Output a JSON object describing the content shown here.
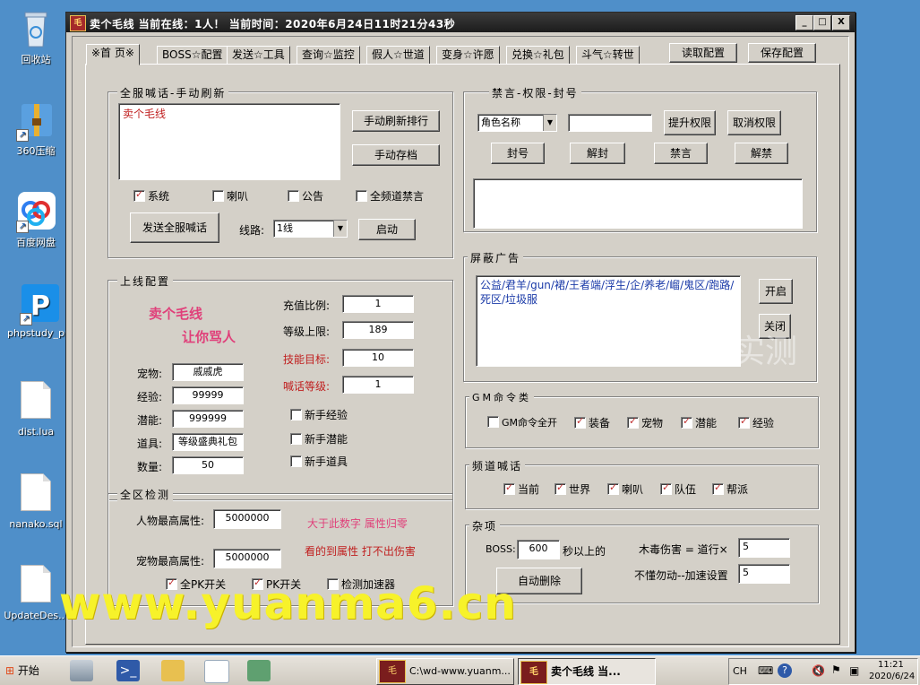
{
  "desktop": {
    "icons": [
      {
        "label": "回收站"
      },
      {
        "label": "360压缩"
      },
      {
        "label": "百度网盘"
      },
      {
        "label": "phpstudy_pro"
      },
      {
        "label": "dist.lua"
      },
      {
        "label": "nanako.sql"
      },
      {
        "label": "UpdateDes..."
      }
    ]
  },
  "window": {
    "title": "卖个毛线    当前在线：1人！  当前时间：2020年6月24日11时21分43秒",
    "title_icon": "毛",
    "controls": [
      "_",
      "□",
      "X"
    ]
  },
  "tabs": [
    {
      "label": "※首 页※",
      "active": true
    },
    {
      "label": "BOSS☆配置"
    },
    {
      "label": "发送☆工具"
    },
    {
      "label": "查询☆监控"
    },
    {
      "label": "假人☆世道"
    },
    {
      "label": "变身☆许愿"
    },
    {
      "label": "兑换☆礼包"
    },
    {
      "label": "斗气☆转世"
    }
  ],
  "toolbar": {
    "read_config": "读取配置",
    "save_config": "保存配置"
  },
  "broadcast": {
    "title": "全服喊话-手动刷新",
    "text": "卖个毛线",
    "refresh_btn": "手动刷新排行",
    "archive_btn": "手动存档",
    "checks": [
      {
        "label": "系统",
        "checked": true
      },
      {
        "label": "喇叭",
        "checked": false
      },
      {
        "label": "公告",
        "checked": false
      },
      {
        "label": "全频道禁言",
        "checked": false
      }
    ],
    "send_btn": "发送全服喊话",
    "line_label": "线路:",
    "line_value": "1线",
    "start_btn": "启动"
  },
  "ban": {
    "title": "禁言-权限-封号",
    "role_select": "角色名称",
    "name_value": "",
    "raise_btn": "提升权限",
    "cancel_btn": "取消权限",
    "ban_btn": "封号",
    "unban_btn": "解封",
    "mute_btn": "禁言",
    "unmute_btn": "解禁"
  },
  "online": {
    "title": "上线配置",
    "slogan1": "卖个毛线",
    "slogan2": "让你骂人",
    "pet_label": "宠物:",
    "pet_value": "戚戚虎",
    "exp_label": "经验:",
    "exp_value": "99999",
    "pot_label": "潜能:",
    "pot_value": "999999",
    "item_label": "道具:",
    "item_value": "等级盛典礼包",
    "qty_label": "数量:",
    "qty_value": "50",
    "ratio_label": "充值比例:",
    "ratio_value": "1",
    "level_label": "等级上限:",
    "level_value": "189",
    "skill_label": "技能目标:",
    "skill_value": "10",
    "shout_label": "喊话等级:",
    "shout_value": "1",
    "newbie_checks": [
      {
        "label": "新手经验",
        "checked": false
      },
      {
        "label": "新手潜能",
        "checked": false
      },
      {
        "label": "新手道具",
        "checked": false
      }
    ]
  },
  "adblock": {
    "title": "屏蔽广告",
    "text": "公益/君羊/gun/裙/王者端/浮生/企/养老/嵧/鬼区/跑路/死区/垃圾服",
    "on_btn": "开启",
    "off_btn": "关闭",
    "faded": "实测"
  },
  "gm": {
    "title": "GM命令类",
    "checks": [
      {
        "label": "GM命令全开",
        "checked": false
      },
      {
        "label": "装备",
        "checked": true
      },
      {
        "label": "宠物",
        "checked": true
      },
      {
        "label": "潜能",
        "checked": true
      },
      {
        "label": "经验",
        "checked": true
      }
    ]
  },
  "channel": {
    "title": "频道喊话",
    "checks": [
      {
        "label": "当前",
        "checked": true
      },
      {
        "label": "世界",
        "checked": true
      },
      {
        "label": "喇叭",
        "checked": true
      },
      {
        "label": "队伍",
        "checked": true
      },
      {
        "label": "帮派",
        "checked": true
      }
    ]
  },
  "zone": {
    "title": "全区检测",
    "char_label": "人物最高属性:",
    "char_value": "5000000",
    "pet_label": "宠物最高属性:",
    "pet_value": "5000000",
    "note1": "大于此数字 属性归零",
    "note2": "看的到属性 打不出伤害",
    "checks": [
      {
        "label": "全PK开关",
        "checked": true
      },
      {
        "label": "PK开关",
        "checked": true
      },
      {
        "label": "检测加速器",
        "checked": false
      }
    ]
  },
  "misc": {
    "title": "杂项",
    "boss_label": "BOSS:",
    "boss_value": "600",
    "boss_suffix": "秒以上的",
    "auto_delete_btn": "自动删除",
    "poison_label": "木毒伤害 = 道行×",
    "poison_value": "5",
    "speed_label": "不懂勿动--加速设置",
    "speed_value": "5"
  },
  "watermark": "www.yuanma6.cn",
  "taskbar": {
    "start": "开始",
    "tasks": [
      {
        "label": "C:\\wd-www.yuanm..."
      },
      {
        "label": "卖个毛线    当..."
      }
    ],
    "lang": "CH",
    "time": "11:21",
    "date": "2020/6/24"
  }
}
